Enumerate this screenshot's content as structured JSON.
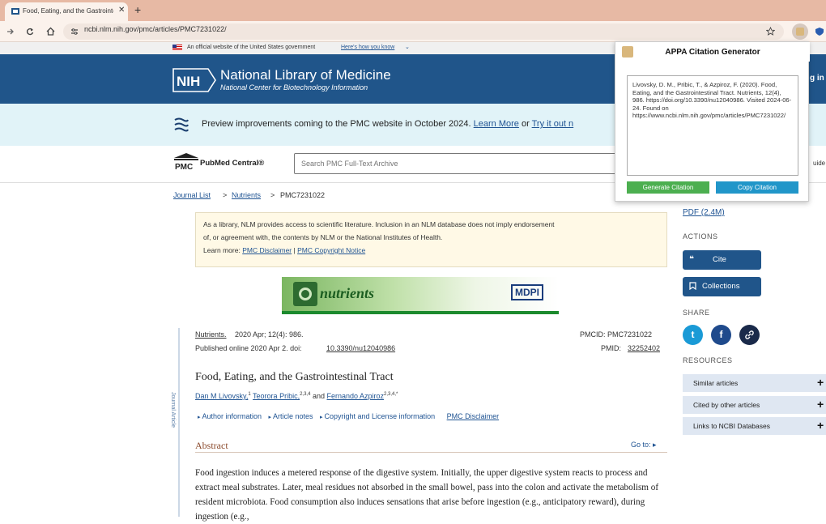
{
  "browser": {
    "tab_title": "Food, Eating, and the Gastrointestinal Tract",
    "tab_close": "✕",
    "new_tab": "+",
    "url": "ncbi.nlm.nih.gov/pmc/articles/PMC7231022/"
  },
  "gov_banner": {
    "text": "An official website of the United States government",
    "link": "Here's how you know"
  },
  "header": {
    "nih": "NIH",
    "title": "National Library of Medicine",
    "subtitle": "National Center for Biotechnology Information",
    "login_partial": "g in"
  },
  "preview_banner": {
    "text": "Preview improvements coming to the PMC website in October 2024.",
    "learn_more": "Learn More",
    "or": "or",
    "try_it": "Try it out n"
  },
  "search": {
    "logo_pmc": "PMC",
    "logo_label": "PubMed Central®",
    "placeholder": "Search PMC Full-Text Archive",
    "guide_partial": "uide"
  },
  "breadcrumb": {
    "journal_list": "Journal List",
    "sep1": ">",
    "nutrients": "Nutrients",
    "sep2": ">",
    "current": "PMC7231022"
  },
  "disclaimer": {
    "line1": "As a library, NLM provides access to scientific literature. Inclusion in an NLM database does not imply endorsement",
    "line2": "of, or agreement with, the contents by NLM or the National Institutes of Health.",
    "learn_more": "Learn more:",
    "pmc_disclaimer": "PMC Disclaimer",
    "sep": "|",
    "copyright_notice": "PMC Copyright Notice"
  },
  "journal_banner": {
    "name": "nutrients",
    "publisher": "MDPI"
  },
  "article": {
    "side_label": "Journal Article",
    "journal_link": "Nutrients.",
    "citation": "2020 Apr; 12(4): 986.",
    "published": "Published online 2020 Apr 2. doi:",
    "doi": "10.3390/nu12040986",
    "pmcid": "PMCID: PMC7231022",
    "pmid_label": "PMID:",
    "pmid": "32252402",
    "title": "Food, Eating, and the Gastrointestinal Tract",
    "authors": [
      {
        "name": "Dan M Livovsky,",
        "sup": "1"
      },
      {
        "name": "Teorora Pribic,",
        "sup": "2,3,4"
      },
      {
        "name": "Fernando Azpiroz",
        "sup": "2,3,4,*"
      }
    ],
    "and": "and",
    "info_links": [
      "Author information",
      "Article notes",
      "Copyright and License information"
    ],
    "pmc_disclaimer": "PMC Disclaimer",
    "abstract_heading": "Abstract",
    "goto": "Go to: ▸",
    "abstract_text": "Food ingestion induces a metered response of the digestive system. Initially, the upper digestive system reacts to process and extract meal substrates. Later, meal residues not absorbed in the small bowel, pass into the colon and activate the metabolism of resident microbiota. Food consumption also induces sensations that arise before ingestion (e.g., anticipatory reward), during ingestion (e.g.,"
  },
  "sidebar": {
    "pdf": "PDF (2.4M)",
    "actions_heading": "ACTIONS",
    "cite": "Cite",
    "cite_icon": "❝",
    "collections": "Collections",
    "share_heading": "SHARE",
    "share_icons": [
      "twitter-icon",
      "facebook-icon",
      "link-icon"
    ],
    "share_glyphs": [
      "t",
      "f",
      "🔗"
    ],
    "resources_heading": "RESOURCES",
    "resources": [
      "Similar articles",
      "Cited by other articles",
      "Links to NCBI Databases"
    ],
    "plus": "+"
  },
  "popup": {
    "title": "APPA Citation Generator",
    "citation": "Livovsky, D. M., Pribic, T., & Azpiroz, F. (2020). Food, Eating, and the Gastrointestinal Tract. Nutrients, 12(4), 986. https://doi.org/10.3390/nu12040986. Visited 2024-06-24. Found on https://www.ncbi.nlm.nih.gov/pmc/articles/PMC7231022/",
    "generate": "Generate Citation",
    "copy": "Copy Citation"
  },
  "colors": {
    "nlm_blue": "#20558a",
    "link_blue": "#205493",
    "generate_green": "#4caf50",
    "copy_blue": "#2196c9"
  }
}
